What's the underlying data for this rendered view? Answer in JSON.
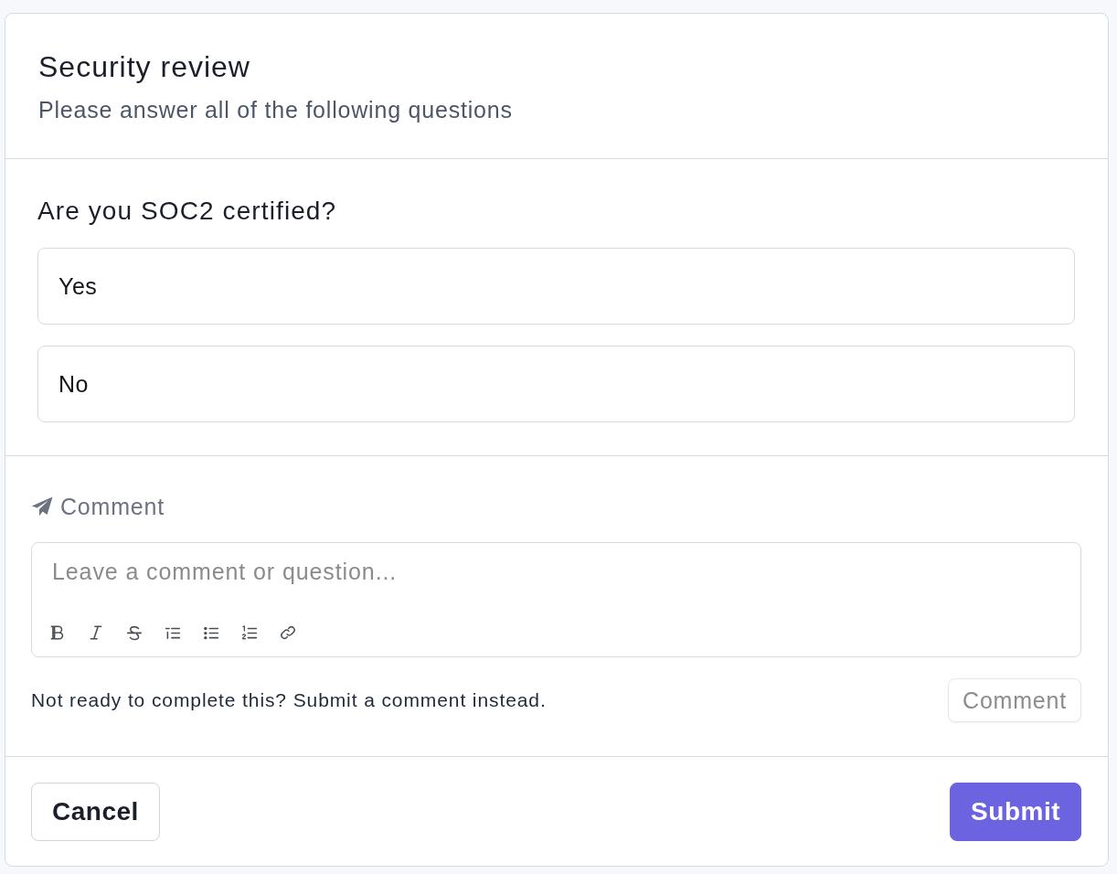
{
  "form": {
    "title": "Security review",
    "subtitle": "Please answer all of the following questions"
  },
  "question": {
    "text": "Are you SOC2 certified?",
    "options": [
      {
        "label": "Yes",
        "selected": false
      },
      {
        "label": "No",
        "selected": false
      }
    ]
  },
  "comment": {
    "label": "Comment",
    "placeholder": "Leave a comment or question...",
    "hint": "Not ready to complete this? Submit a comment instead.",
    "button": {
      "label": "Comment",
      "disabled": true
    }
  },
  "footer": {
    "buttons": [
      {
        "label": "Cancel",
        "kind": "secondary"
      },
      {
        "label": "Submit",
        "kind": "primary"
      }
    ]
  }
}
